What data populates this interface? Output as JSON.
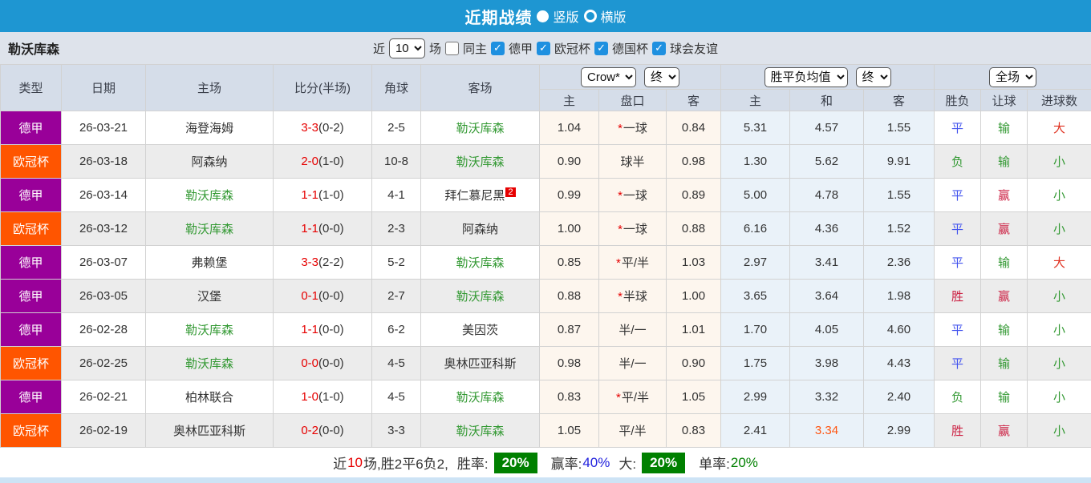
{
  "topbar": {
    "title": "近期战绩",
    "radio_vertical": "竖版",
    "radio_horizontal": "横版",
    "selected": "竖版"
  },
  "filter": {
    "team": "勒沃库森",
    "jin_label": "近",
    "games_select": "10",
    "chang_label": "场",
    "tongzhu_label": "同主",
    "leagues": [
      "德甲",
      "欧冠杯",
      "德国杯",
      "球会友谊"
    ]
  },
  "table": {
    "header_row1": {
      "type": "类型",
      "date": "日期",
      "home": "主场",
      "score": "比分(半场)",
      "corner": "角球",
      "away": "客场",
      "odds_provider_select": "Crow*",
      "odds_time_select": "终",
      "avg_type_select": "胜平负均值",
      "avg_time_select": "终",
      "scope_select": "全场"
    },
    "header_row2": [
      "主",
      "盘口",
      "客",
      "主",
      "和",
      "客",
      "胜负",
      "让球",
      "进球数"
    ],
    "rows": [
      {
        "league": "德甲",
        "date": "26-03-21",
        "home": "海登海姆",
        "home_self": false,
        "score": "3-3",
        "half": "(0-2)",
        "corner": "2-5",
        "away": "勒沃库森",
        "away_self": true,
        "away_sup": "",
        "crown_home": "1.04",
        "handicap": "一球",
        "handicap_star": true,
        "crown_away": "0.84",
        "avg_win": "5.31",
        "avg_draw": "4.57",
        "avg_lose": "1.55",
        "avg_draw_hl": false,
        "result": "平",
        "handicap_result": "输",
        "goals": "大"
      },
      {
        "league": "欧冠杯",
        "date": "26-03-18",
        "home": "阿森纳",
        "home_self": false,
        "score": "2-0",
        "half": "(1-0)",
        "corner": "10-8",
        "away": "勒沃库森",
        "away_self": true,
        "away_sup": "",
        "crown_home": "0.90",
        "handicap": "球半",
        "handicap_star": false,
        "crown_away": "0.98",
        "avg_win": "1.30",
        "avg_draw": "5.62",
        "avg_lose": "9.91",
        "avg_draw_hl": false,
        "result": "负",
        "handicap_result": "输",
        "goals": "小"
      },
      {
        "league": "德甲",
        "date": "26-03-14",
        "home": "勒沃库森",
        "home_self": true,
        "score": "1-1",
        "half": "(1-0)",
        "corner": "4-1",
        "away": "拜仁慕尼黑",
        "away_self": false,
        "away_sup": "2",
        "crown_home": "0.99",
        "handicap": "一球",
        "handicap_star": true,
        "crown_away": "0.89",
        "avg_win": "5.00",
        "avg_draw": "4.78",
        "avg_lose": "1.55",
        "avg_draw_hl": false,
        "result": "平",
        "handicap_result": "赢",
        "goals": "小"
      },
      {
        "league": "欧冠杯",
        "date": "26-03-12",
        "home": "勒沃库森",
        "home_self": true,
        "score": "1-1",
        "half": "(0-0)",
        "corner": "2-3",
        "away": "阿森纳",
        "away_self": false,
        "away_sup": "",
        "crown_home": "1.00",
        "handicap": "一球",
        "handicap_star": true,
        "crown_away": "0.88",
        "avg_win": "6.16",
        "avg_draw": "4.36",
        "avg_lose": "1.52",
        "avg_draw_hl": false,
        "result": "平",
        "handicap_result": "赢",
        "goals": "小"
      },
      {
        "league": "德甲",
        "date": "26-03-07",
        "home": "弗赖堡",
        "home_self": false,
        "score": "3-3",
        "half": "(2-2)",
        "corner": "5-2",
        "away": "勒沃库森",
        "away_self": true,
        "away_sup": "",
        "crown_home": "0.85",
        "handicap": "平/半",
        "handicap_star": true,
        "crown_away": "1.03",
        "avg_win": "2.97",
        "avg_draw": "3.41",
        "avg_lose": "2.36",
        "avg_draw_hl": false,
        "result": "平",
        "handicap_result": "输",
        "goals": "大"
      },
      {
        "league": "德甲",
        "date": "26-03-05",
        "home": "汉堡",
        "home_self": false,
        "score": "0-1",
        "half": "(0-0)",
        "corner": "2-7",
        "away": "勒沃库森",
        "away_self": true,
        "away_sup": "",
        "crown_home": "0.88",
        "handicap": "半球",
        "handicap_star": true,
        "crown_away": "1.00",
        "avg_win": "3.65",
        "avg_draw": "3.64",
        "avg_lose": "1.98",
        "avg_draw_hl": false,
        "result": "胜",
        "handicap_result": "赢",
        "goals": "小"
      },
      {
        "league": "德甲",
        "date": "26-02-28",
        "home": "勒沃库森",
        "home_self": true,
        "score": "1-1",
        "half": "(0-0)",
        "corner": "6-2",
        "away": "美因茨",
        "away_self": false,
        "away_sup": "",
        "crown_home": "0.87",
        "handicap": "半/一",
        "handicap_star": false,
        "crown_away": "1.01",
        "avg_win": "1.70",
        "avg_draw": "4.05",
        "avg_lose": "4.60",
        "avg_draw_hl": false,
        "result": "平",
        "handicap_result": "输",
        "goals": "小"
      },
      {
        "league": "欧冠杯",
        "date": "26-02-25",
        "home": "勒沃库森",
        "home_self": true,
        "score": "0-0",
        "half": "(0-0)",
        "corner": "4-5",
        "away": "奥林匹亚科斯",
        "away_self": false,
        "away_sup": "",
        "crown_home": "0.98",
        "handicap": "半/一",
        "handicap_star": false,
        "crown_away": "0.90",
        "avg_win": "1.75",
        "avg_draw": "3.98",
        "avg_lose": "4.43",
        "avg_draw_hl": false,
        "result": "平",
        "handicap_result": "输",
        "goals": "小"
      },
      {
        "league": "德甲",
        "date": "26-02-21",
        "home": "柏林联合",
        "home_self": false,
        "score": "1-0",
        "half": "(1-0)",
        "corner": "4-5",
        "away": "勒沃库森",
        "away_self": true,
        "away_sup": "",
        "crown_home": "0.83",
        "handicap": "平/半",
        "handicap_star": true,
        "crown_away": "1.05",
        "avg_win": "2.99",
        "avg_draw": "3.32",
        "avg_lose": "2.40",
        "avg_draw_hl": false,
        "result": "负",
        "handicap_result": "输",
        "goals": "小"
      },
      {
        "league": "欧冠杯",
        "date": "26-02-19",
        "home": "奥林匹亚科斯",
        "home_self": false,
        "score": "0-2",
        "half": "(0-0)",
        "corner": "3-3",
        "away": "勒沃库森",
        "away_self": true,
        "away_sup": "",
        "crown_home": "1.05",
        "handicap": "平/半",
        "handicap_star": false,
        "crown_away": "0.83",
        "avg_win": "2.41",
        "avg_draw": "3.34",
        "avg_lose": "2.99",
        "avg_draw_hl": true,
        "result": "胜",
        "handicap_result": "赢",
        "goals": "小"
      }
    ]
  },
  "summary": {
    "jin": "近",
    "games": "10",
    "record": "场,胜2平6负2,",
    "win_rate_label": "胜率:",
    "win_rate": "20%",
    "yield_label": "赢率:",
    "yield_rate": "40%",
    "big_label": "大:",
    "big_rate": "20%",
    "single_label": "单率:",
    "single_rate": "20%"
  },
  "colors": {
    "topbar_blue": "#1e96d2",
    "league_dejia": "#990099",
    "league_ouguanbei": "#ff5500",
    "win_red": "#cc2244",
    "draw_blue": "#4455ee",
    "lose_green": "#339933",
    "team_green": "#339933",
    "score_red": "#e60000",
    "big_red": "#e03322",
    "small_green": "#339933",
    "highlight_orange": "#ff5511",
    "badge_green": "#008000"
  }
}
